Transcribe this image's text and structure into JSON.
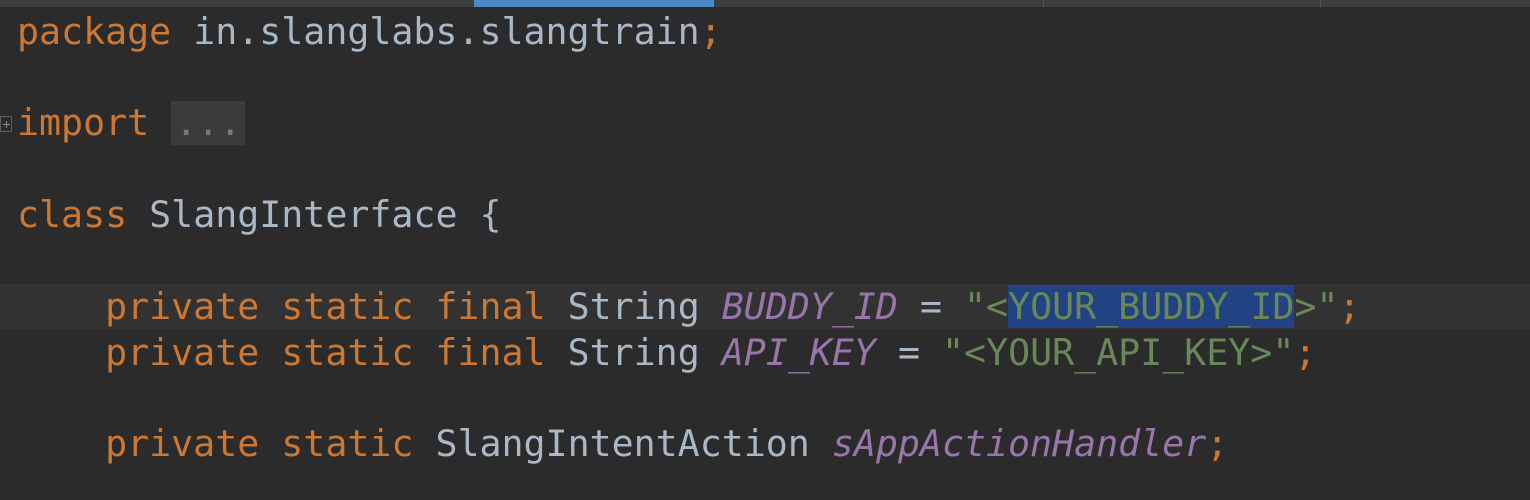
{
  "code": {
    "package_line": {
      "keyword": "package",
      "name": "in.slanglabs.slangtrain",
      "terminator": ";"
    },
    "import_line": {
      "keyword": "import",
      "folded": "..."
    },
    "class_line": {
      "keyword": "class",
      "name": "SlangInterface",
      "brace": "{"
    },
    "field_buddy": {
      "modifiers": "private static final",
      "type": "String",
      "name": "BUDDY_ID",
      "equals": "=",
      "quote_open": "\"<",
      "value_selected": "YOUR_BUDDY_ID",
      "quote_close": ">\"",
      "terminator": ";"
    },
    "field_api": {
      "modifiers": "private static final",
      "type": "String",
      "name": "API_KEY",
      "equals": "=",
      "value": "\"<YOUR_API_KEY>\"",
      "terminator": ";"
    },
    "field_handler": {
      "modifiers": "private static",
      "type": "SlangIntentAction",
      "name": "sAppActionHandler",
      "terminator": ";"
    }
  },
  "colors": {
    "background": "#2b2b2b",
    "caret_row": "#323232",
    "keyword": "#cc7832",
    "identifier": "#a9b7c6",
    "constant": "#9876aa",
    "string": "#6a8759",
    "selection": "#214283"
  },
  "icons": {
    "fold_marker": "plus-square-icon"
  }
}
